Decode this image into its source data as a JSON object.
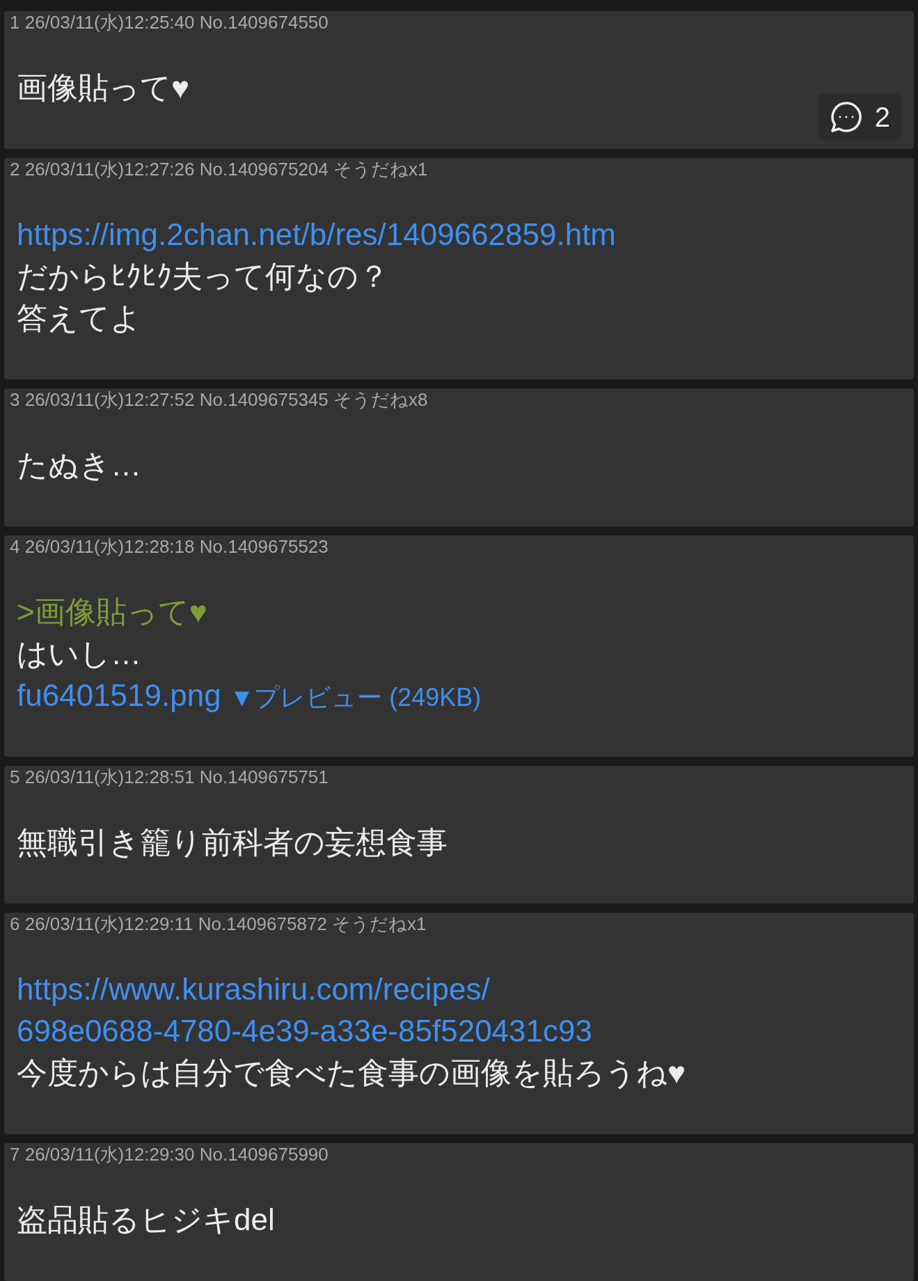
{
  "posts": [
    {
      "header": "1 26/03/11(水)12:25:40 No.1409674550",
      "lines": [
        {
          "kind": "text",
          "text": "画像貼って♥"
        }
      ],
      "reply_count": "2"
    },
    {
      "header": "2 26/03/11(水)12:27:26 No.1409675204 そうだねx1",
      "lines": [
        {
          "kind": "link",
          "text": "https://img.2chan.net/b/res/1409662859.htm"
        },
        {
          "kind": "text",
          "text": "だからﾋｸﾋｸ夫って何なの？"
        },
        {
          "kind": "text",
          "text": "答えてよ"
        }
      ]
    },
    {
      "header": "3 26/03/11(水)12:27:52 No.1409675345 そうだねx8",
      "lines": [
        {
          "kind": "text",
          "text": "たぬき…"
        }
      ]
    },
    {
      "header": "4 26/03/11(水)12:28:18 No.1409675523",
      "lines": [
        {
          "kind": "quote",
          "text": ">画像貼って♥"
        },
        {
          "kind": "text",
          "text": "はいし…"
        },
        {
          "kind": "file",
          "text": "fu6401519.png",
          "preview": "▼プレビュー (249KB)"
        }
      ]
    },
    {
      "header": "5 26/03/11(水)12:28:51 No.1409675751",
      "lines": [
        {
          "kind": "text",
          "text": "無職引き籠り前科者の妄想食事"
        }
      ]
    },
    {
      "header": "6 26/03/11(水)12:29:11 No.1409675872 そうだねx1",
      "lines": [
        {
          "kind": "link",
          "text": "https://www.kurashiru.com/recipes/"
        },
        {
          "kind": "link",
          "text": "698e0688-4780-4e39-a33e-85f520431c93"
        },
        {
          "kind": "text",
          "text": "今度からは自分で食べた食事の画像を貼ろうね♥"
        }
      ]
    },
    {
      "header": "7 26/03/11(水)12:29:30 No.1409675990",
      "lines": [
        {
          "kind": "text",
          "text": "盗品貼るヒジキdel"
        }
      ]
    }
  ]
}
